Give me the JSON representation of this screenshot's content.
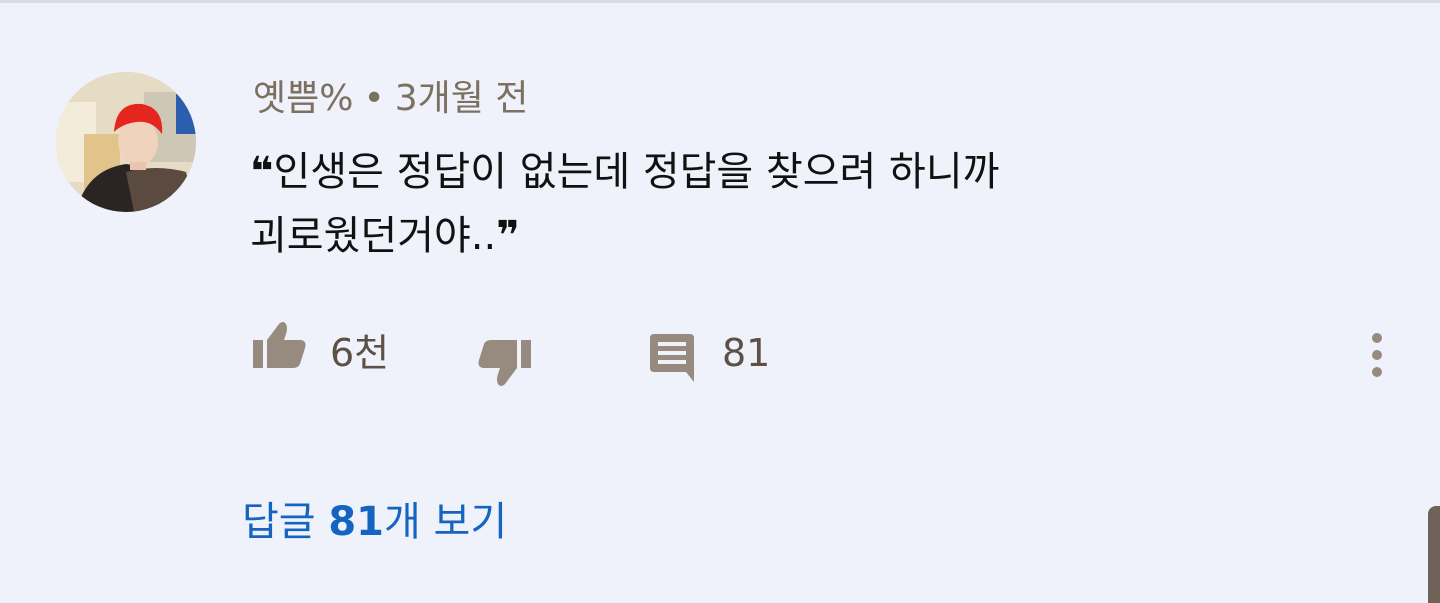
{
  "comment": {
    "author": "옛쁨%",
    "separator": "•",
    "time": "3개월 전",
    "open_quote": "❝",
    "close_quote": "❞",
    "text_line1": "인생은 정답이 없는데 정답을 찾으려 하니까",
    "text_line2": "괴로웠던거야.."
  },
  "actions": {
    "like_count": "6천",
    "reply_count": "81",
    "like_icon": "thumbs-up-icon",
    "dislike_icon": "thumbs-down-icon",
    "reply_icon": "comment-icon",
    "more_icon": "more-vertical-icon"
  },
  "replies": {
    "prefix": "답글 ",
    "count": "81",
    "suffix": "개 보기"
  },
  "colors": {
    "background": "#eff2fa",
    "meta_text": "#7c7060",
    "icon": "#978a7e",
    "link": "#1565c0"
  }
}
